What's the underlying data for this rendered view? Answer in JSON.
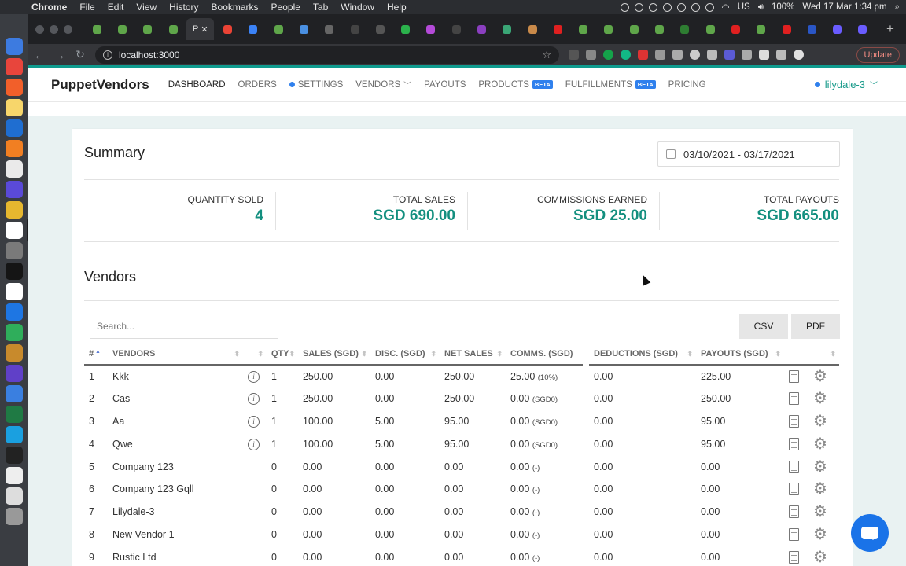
{
  "menubar": {
    "app": "Chrome",
    "items": [
      "File",
      "Edit",
      "View",
      "History",
      "Bookmarks",
      "People",
      "Tab",
      "Window",
      "Help"
    ],
    "locale": "US",
    "battery": "100%",
    "datetime": "Wed 17 Mar  1:34 pm"
  },
  "browser": {
    "active_tab_label": "P",
    "url": "localhost:3000",
    "update_label": "Update",
    "new_tab_symbol": "+",
    "accent": "#0f9b8e"
  },
  "nav": {
    "brand": "PuppetVendors",
    "links": {
      "dashboard": "DASHBOARD",
      "orders": "ORDERS",
      "settings": "SETTINGS",
      "vendors": "VENDORS",
      "payouts": "PAYOUTS",
      "products": "PRODUCTS",
      "fulfillments": "FULFILLMENTS",
      "pricing": "PRICING"
    },
    "beta": "BETA",
    "user": "lilydale-3"
  },
  "summary": {
    "title": "Summary",
    "date_range": "03/10/2021 - 03/17/2021",
    "stats": [
      {
        "label": "QUANTITY SOLD",
        "value": "4"
      },
      {
        "label": "TOTAL SALES",
        "value": "SGD 690.00"
      },
      {
        "label": "COMMISSIONS EARNED",
        "value": "SGD 25.00"
      },
      {
        "label": "TOTAL PAYOUTS",
        "value": "SGD 665.00"
      }
    ]
  },
  "vendors": {
    "title": "Vendors",
    "search_placeholder": "Search...",
    "csv_label": "CSV",
    "pdf_label": "PDF",
    "columns": {
      "num": "#",
      "vendor": "VENDORS",
      "qty": "QTY",
      "sales": "SALES (SGD)",
      "disc": "DISC. (SGD)",
      "net": "NET SALES",
      "comms": "COMMS. (SGD)",
      "deductions": "DEDUCTIONS (SGD)",
      "payouts": "PAYOUTS (SGD)"
    },
    "rows": [
      {
        "n": "1",
        "name": "Kkk",
        "info": true,
        "qty": "1",
        "sales": "250.00",
        "disc": "0.00",
        "net": "250.00",
        "comm": "25.00",
        "comm_note": "(10%)",
        "ded": "0.00",
        "pay": "225.00"
      },
      {
        "n": "2",
        "name": "Cas",
        "info": true,
        "qty": "1",
        "sales": "250.00",
        "disc": "0.00",
        "net": "250.00",
        "comm": "0.00",
        "comm_note": "(SGD0)",
        "ded": "0.00",
        "pay": "250.00"
      },
      {
        "n": "3",
        "name": "Aa",
        "info": true,
        "qty": "1",
        "sales": "100.00",
        "disc": "5.00",
        "net": "95.00",
        "comm": "0.00",
        "comm_note": "(SGD0)",
        "ded": "0.00",
        "pay": "95.00"
      },
      {
        "n": "4",
        "name": "Qwe",
        "info": true,
        "qty": "1",
        "sales": "100.00",
        "disc": "5.00",
        "net": "95.00",
        "comm": "0.00",
        "comm_note": "(SGD0)",
        "ded": "0.00",
        "pay": "95.00"
      },
      {
        "n": "5",
        "name": "Company 123",
        "info": false,
        "qty": "0",
        "sales": "0.00",
        "disc": "0.00",
        "net": "0.00",
        "comm": "0.00",
        "comm_note": "(-)",
        "ded": "0.00",
        "pay": "0.00"
      },
      {
        "n": "6",
        "name": "Company 123 Gqll",
        "info": false,
        "qty": "0",
        "sales": "0.00",
        "disc": "0.00",
        "net": "0.00",
        "comm": "0.00",
        "comm_note": "(-)",
        "ded": "0.00",
        "pay": "0.00"
      },
      {
        "n": "7",
        "name": "Lilydale-3",
        "info": false,
        "qty": "0",
        "sales": "0.00",
        "disc": "0.00",
        "net": "0.00",
        "comm": "0.00",
        "comm_note": "(-)",
        "ded": "0.00",
        "pay": "0.00"
      },
      {
        "n": "8",
        "name": "New Vendor 1",
        "info": false,
        "qty": "0",
        "sales": "0.00",
        "disc": "0.00",
        "net": "0.00",
        "comm": "0.00",
        "comm_note": "(-)",
        "ded": "0.00",
        "pay": "0.00"
      },
      {
        "n": "9",
        "name": "Rustic Ltd",
        "info": false,
        "qty": "0",
        "sales": "0.00",
        "disc": "0.00",
        "net": "0.00",
        "comm": "0.00",
        "comm_note": "(-)",
        "ded": "0.00",
        "pay": "0.00"
      }
    ]
  }
}
